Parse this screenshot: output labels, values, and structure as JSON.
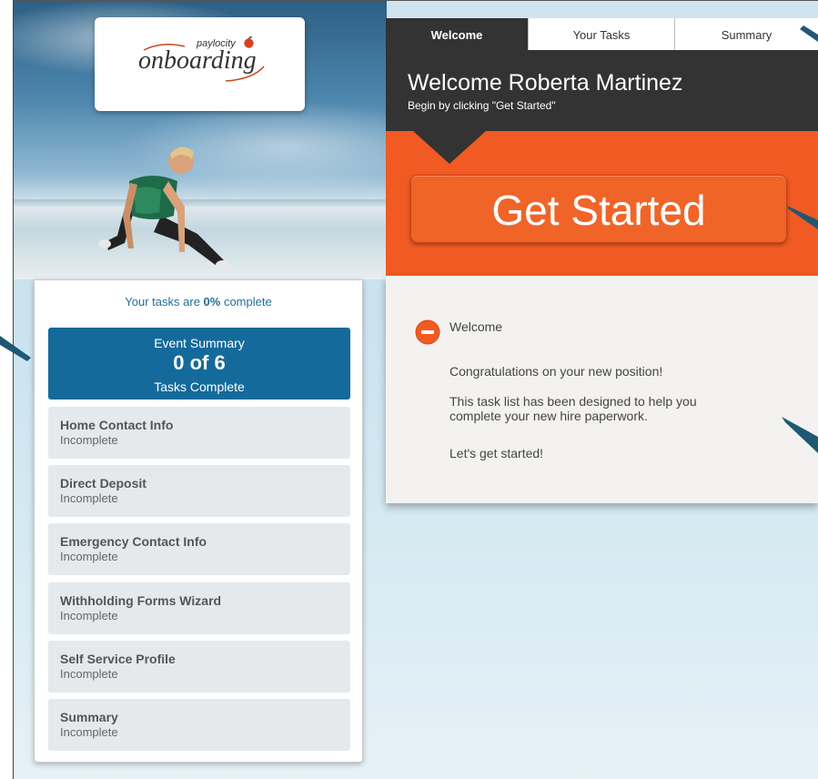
{
  "logo": {
    "brand": "paylocity",
    "product": "onboarding"
  },
  "progress": {
    "prefix": "Your tasks are ",
    "percent": "0%",
    "suffix": " complete"
  },
  "event_summary": {
    "title": "Event Summary",
    "count": "0 of 6",
    "subtitle": "Tasks Complete"
  },
  "tasks": [
    {
      "name": "Home Contact Info",
      "status": "Incomplete"
    },
    {
      "name": "Direct Deposit",
      "status": "Incomplete"
    },
    {
      "name": "Emergency Contact Info",
      "status": "Incomplete"
    },
    {
      "name": "Withholding Forms Wizard",
      "status": "Incomplete"
    },
    {
      "name": "Self Service Profile",
      "status": "Incomplete"
    },
    {
      "name": "Summary",
      "status": "Incomplete"
    }
  ],
  "tabs": [
    {
      "label": "Welcome",
      "active": true
    },
    {
      "label": "Your Tasks",
      "active": false
    },
    {
      "label": "Summary",
      "active": false
    }
  ],
  "welcome": {
    "title": "Welcome Roberta Martinez",
    "subtitle": "Begin by clicking \"Get Started\""
  },
  "get_started_label": "Get Started",
  "content": {
    "section_label": "Welcome",
    "line1": "Congratulations on your new position!",
    "line2a": "This task list has been designed to help you",
    "line2b": "complete your new hire paperwork.",
    "line3": "Let's get started!"
  },
  "colors": {
    "accent_blue": "#146a9b",
    "accent_orange": "#f15a22",
    "dark_band": "#333333"
  },
  "icons": [
    "apple-logo-icon",
    "collapse-minus-icon",
    "callout-pointer-icon"
  ]
}
